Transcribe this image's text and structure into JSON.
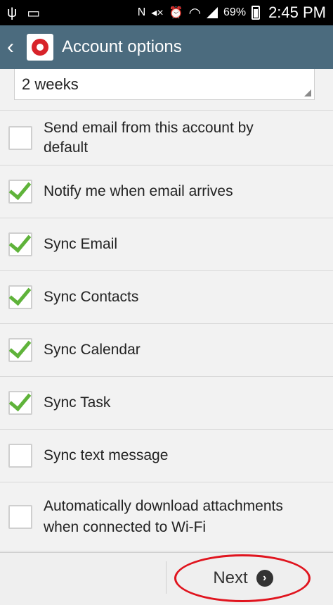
{
  "status_bar": {
    "time": "2:45 PM",
    "battery_percent": "69%",
    "icons": [
      "usb-icon",
      "image-icon",
      "nfc-icon",
      "mute-icon",
      "alarm-icon",
      "wifi-icon",
      "signal-icon",
      "battery-icon"
    ]
  },
  "header": {
    "title": "Account options"
  },
  "sync_schedule": {
    "value": "2 weeks"
  },
  "options": [
    {
      "label": "Send email from this account by default",
      "checked": false
    },
    {
      "label": "Notify me when email arrives",
      "checked": true
    },
    {
      "label": "Sync Email",
      "checked": true
    },
    {
      "label": "Sync Contacts",
      "checked": true
    },
    {
      "label": "Sync Calendar",
      "checked": true
    },
    {
      "label": "Sync Task",
      "checked": true
    },
    {
      "label": "Sync text message",
      "checked": false
    },
    {
      "label": "Automatically download attachments when connected to Wi-Fi",
      "checked": false
    }
  ],
  "footer": {
    "next_label": "Next"
  },
  "colors": {
    "action_bar": "#4b6b7e",
    "check": "#5fb33a",
    "highlight": "#e0141e"
  }
}
